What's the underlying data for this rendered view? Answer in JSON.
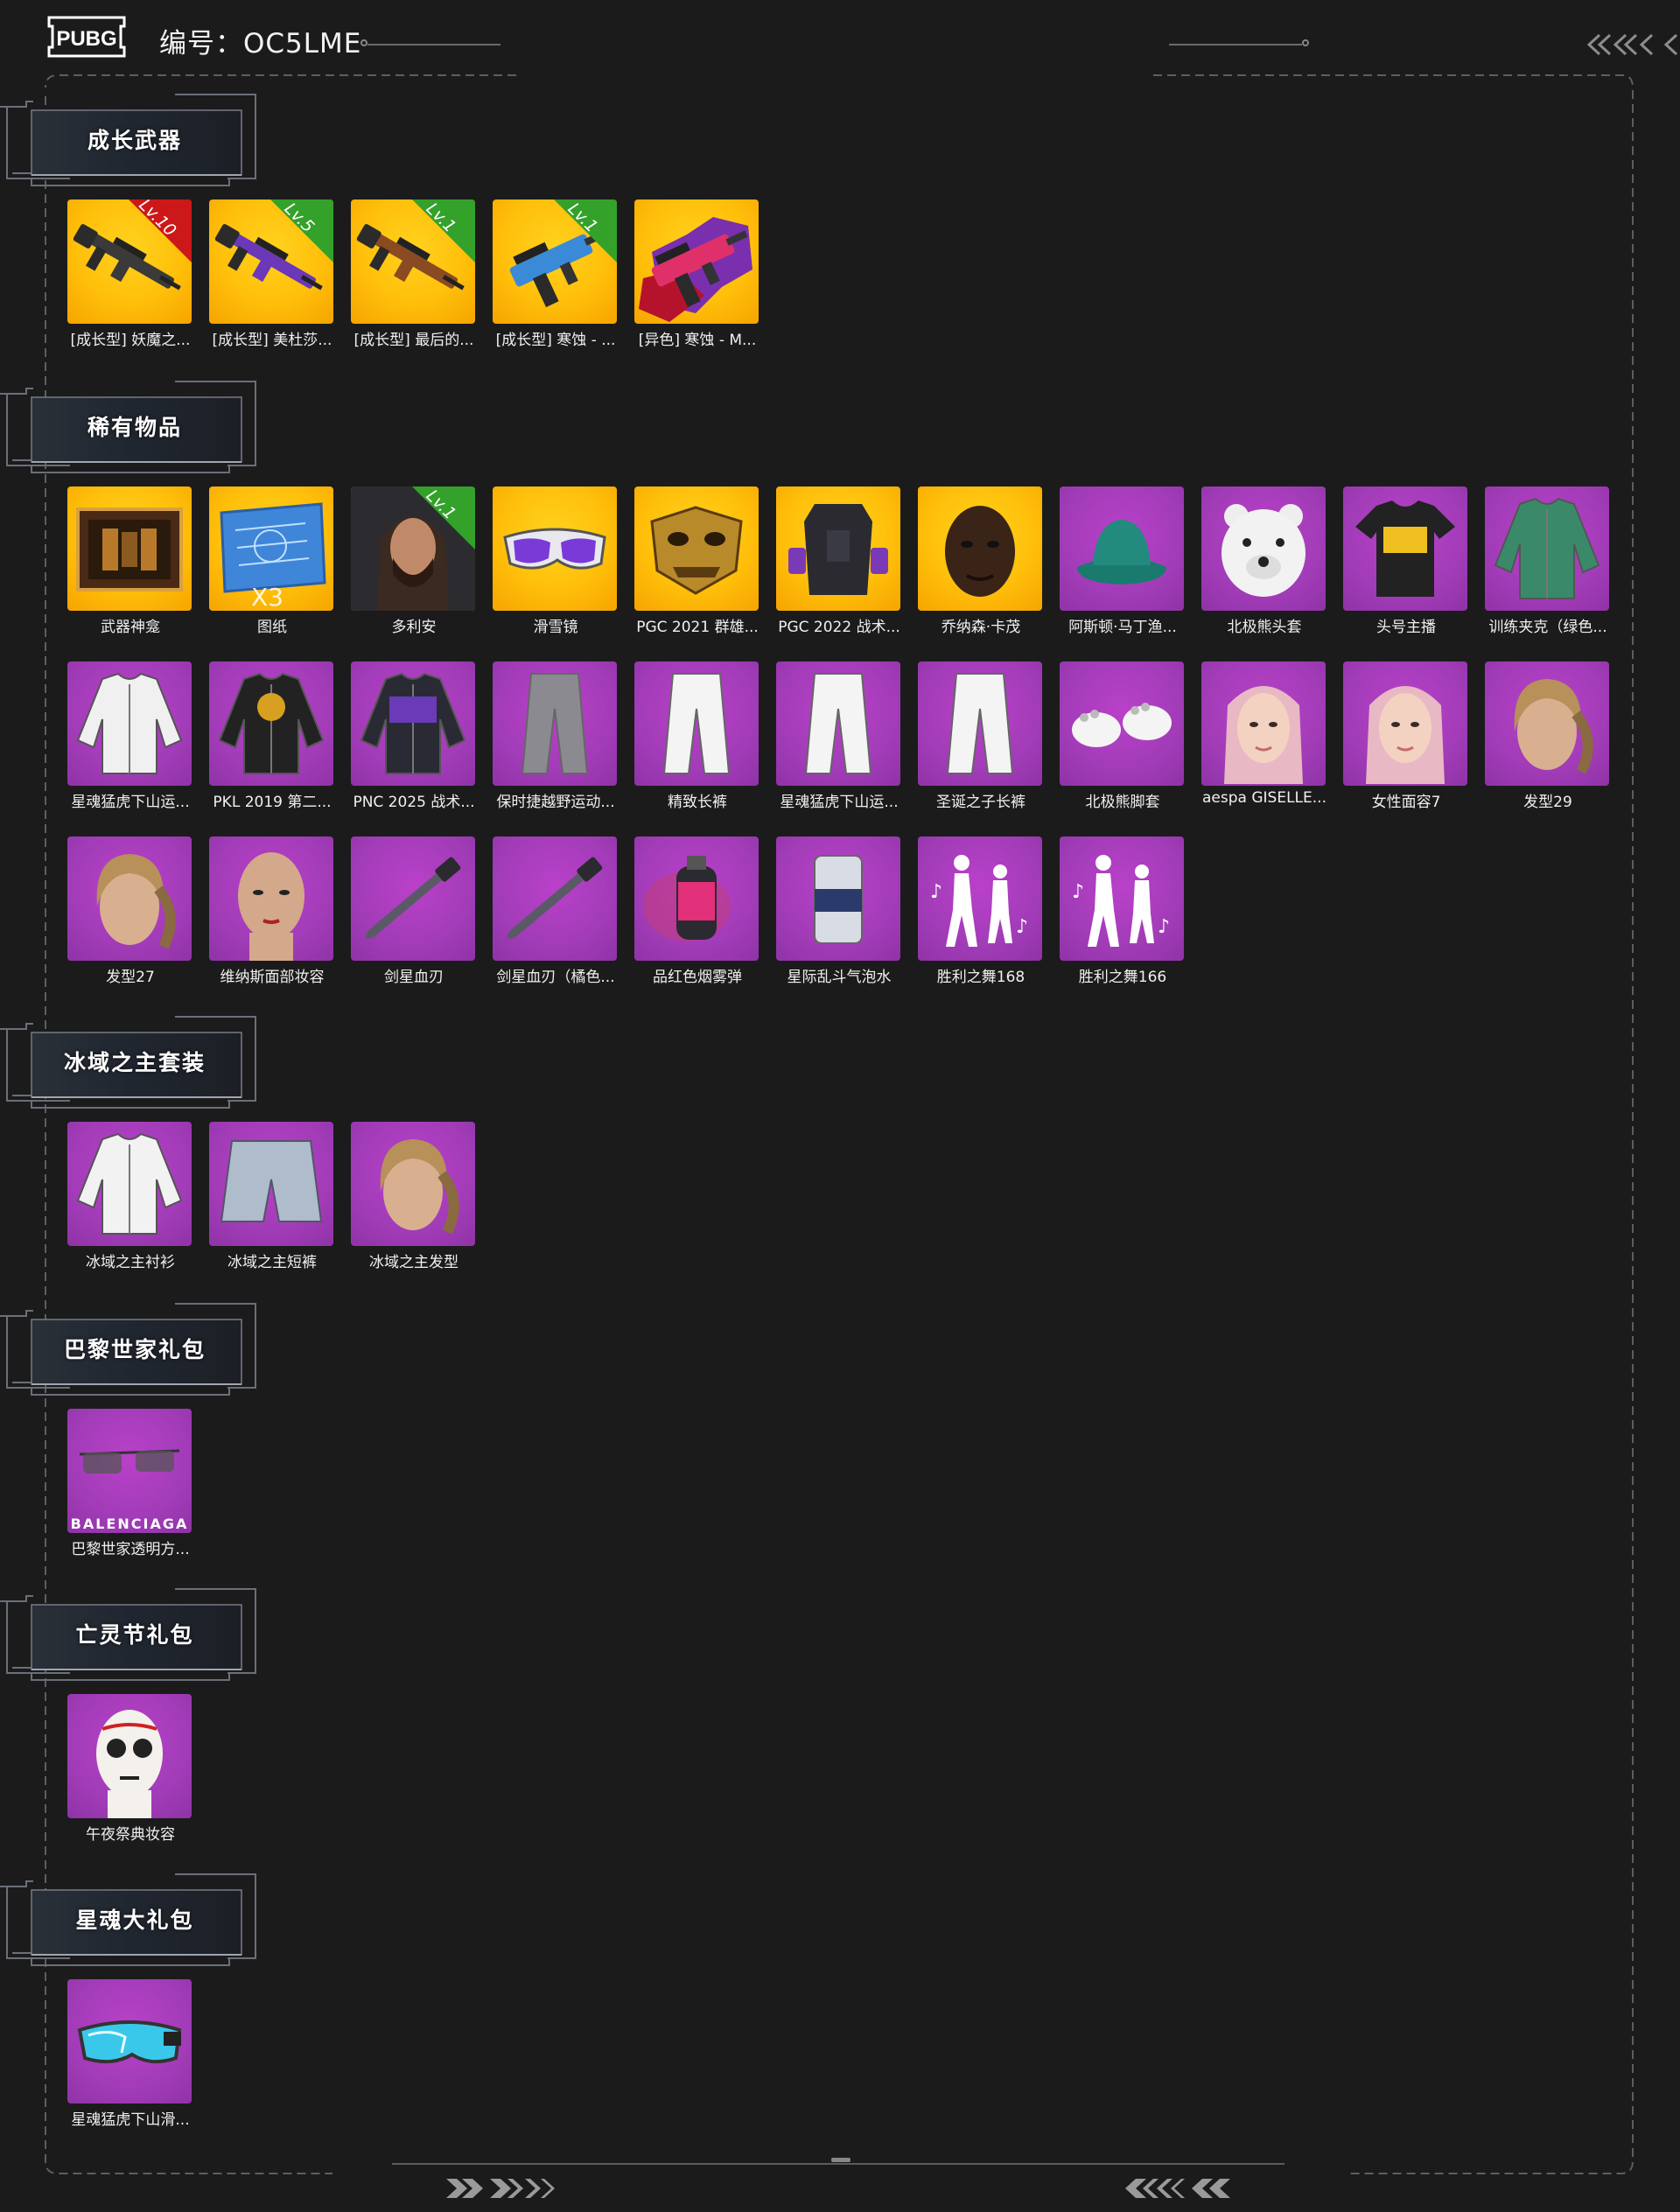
{
  "header": {
    "logo_text": "PUBG",
    "serial_label": "编号：",
    "serial_value": "OC5LME"
  },
  "colors": {
    "background": "#1b1b1c",
    "gold_tile": "#ffbf0a",
    "purple_tile": "#a23cb8",
    "lv_red": "#cc1818",
    "lv_green": "#33a12a"
  },
  "sections": [
    {
      "title": "成长武器",
      "items": [
        {
          "label": "[成长型] 妖魔之...",
          "tile": "gold",
          "icon": "rifle-icon",
          "level": "Lv.10",
          "level_color": "red"
        },
        {
          "label": "[成长型] 美杜莎...",
          "tile": "gold",
          "icon": "purple-rifle-icon",
          "level": "Lv.5",
          "level_color": "green"
        },
        {
          "label": "[成长型] 最后的...",
          "tile": "gold",
          "icon": "sniper-rifle-icon",
          "level": "Lv.1",
          "level_color": "green"
        },
        {
          "label": "[成长型] 寒蚀 - ...",
          "tile": "gold",
          "icon": "smg-icon",
          "level": "Lv.1",
          "level_color": "green"
        },
        {
          "label": "[异色] 寒蚀 - M...",
          "tile": "gold",
          "icon": "pink-smg-icon"
        }
      ]
    },
    {
      "title": "稀有物品",
      "items": [
        {
          "label": "武器神龛",
          "tile": "gold",
          "icon": "weapon-shrine-icon"
        },
        {
          "label": "图纸",
          "tile": "gold",
          "icon": "blueprint-icon",
          "quantity": "X3"
        },
        {
          "label": "多利安",
          "tile": "gold",
          "icon": "character-portrait-icon",
          "level": "Lv.1",
          "level_color": "green"
        },
        {
          "label": "滑雪镜",
          "tile": "gold",
          "icon": "ski-goggles-icon"
        },
        {
          "label": "PGC 2021 群雄...",
          "tile": "gold",
          "icon": "gold-mask-icon"
        },
        {
          "label": "PGC 2022 战术...",
          "tile": "gold",
          "icon": "tactical-vest-icon"
        },
        {
          "label": "乔纳森·卡茂",
          "tile": "gold",
          "icon": "character-face-icon"
        },
        {
          "label": "阿斯顿·马丁渔...",
          "tile": "purple",
          "icon": "bucket-hat-icon"
        },
        {
          "label": "北极熊头套",
          "tile": "purple",
          "icon": "polar-bear-head-icon"
        },
        {
          "label": "头号主播",
          "tile": "purple",
          "icon": "tshirt-icon"
        },
        {
          "label": "训练夹克（绿色...",
          "tile": "purple",
          "icon": "green-jacket-icon"
        },
        {
          "label": "星魂猛虎下山运...",
          "tile": "purple",
          "icon": "white-jacket-icon"
        },
        {
          "label": "PKL 2019 第二...",
          "tile": "purple",
          "icon": "league-jacket-icon"
        },
        {
          "label": "PNC 2025 战术...",
          "tile": "purple",
          "icon": "tactical-top-icon"
        },
        {
          "label": "保时捷越野运动...",
          "tile": "purple",
          "icon": "grey-pants-icon"
        },
        {
          "label": "精致长裤",
          "tile": "purple",
          "icon": "white-pants-icon"
        },
        {
          "label": "星魂猛虎下山运...",
          "tile": "purple",
          "icon": "white-pants-icon"
        },
        {
          "label": "圣诞之子长裤",
          "tile": "purple",
          "icon": "white-pants-icon"
        },
        {
          "label": "北极熊脚套",
          "tile": "purple",
          "icon": "bear-paws-icon"
        },
        {
          "label": "aespa GISELLE...",
          "tile": "purple",
          "icon": "female-face-icon"
        },
        {
          "label": "女性面容7",
          "tile": "purple",
          "icon": "female-face-icon"
        },
        {
          "label": "发型29",
          "tile": "purple",
          "icon": "hairstyle-icon"
        },
        {
          "label": "发型27",
          "tile": "purple",
          "icon": "hairstyle-icon"
        },
        {
          "label": "维纳斯面部妆容",
          "tile": "purple",
          "icon": "face-makeup-icon"
        },
        {
          "label": "剑星血刃",
          "tile": "purple",
          "icon": "blade-icon"
        },
        {
          "label": "剑星血刃（橘色...",
          "tile": "purple",
          "icon": "blade-icon"
        },
        {
          "label": "品红色烟雾弹",
          "tile": "purple",
          "icon": "smoke-grenade-icon"
        },
        {
          "label": "星际乱斗气泡水",
          "tile": "purple",
          "icon": "soda-can-icon"
        },
        {
          "label": "胜利之舞168",
          "tile": "purple",
          "icon": "dance-emote-icon"
        },
        {
          "label": "胜利之舞166",
          "tile": "purple",
          "icon": "dance-emote-icon"
        }
      ]
    },
    {
      "title": "冰域之主套装",
      "items": [
        {
          "label": "冰域之主衬衫",
          "tile": "purple",
          "icon": "white-shirt-icon"
        },
        {
          "label": "冰域之主短裤",
          "tile": "purple",
          "icon": "shorts-icon"
        },
        {
          "label": "冰域之主发型",
          "tile": "purple",
          "icon": "hairstyle-icon"
        }
      ]
    },
    {
      "title": "巴黎世家礼包",
      "items": [
        {
          "label": "巴黎世家透明方...",
          "tile": "purple",
          "icon": "sunglasses-icon",
          "brand": "BALENCIAGA"
        }
      ]
    },
    {
      "title": "亡灵节礼包",
      "items": [
        {
          "label": "午夜祭典妆容",
          "tile": "purple",
          "icon": "skull-makeup-icon"
        }
      ]
    },
    {
      "title": "星魂大礼包",
      "items": [
        {
          "label": "星魂猛虎下山滑...",
          "tile": "purple",
          "icon": "blue-goggles-icon"
        }
      ]
    }
  ]
}
